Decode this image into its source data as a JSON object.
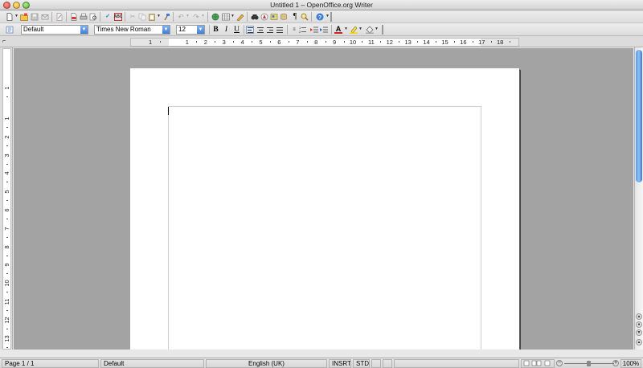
{
  "window": {
    "title": "Untitled 1 – OpenOffice.org Writer"
  },
  "formatting_toolbar": {
    "paragraph_style": "Default",
    "font_name": "Times New Roman",
    "font_size": "12",
    "bold_label": "B",
    "italic_label": "I",
    "underline_label": "U"
  },
  "standard_toolbar": {
    "icons": [
      "new-icon",
      "open-icon",
      "save-icon",
      "email-icon",
      "edit-file-icon",
      "pdf-export-icon",
      "print-icon",
      "page-preview-icon",
      "spellcheck-icon",
      "autospellcheck-icon",
      "cut-icon",
      "copy-icon",
      "paste-icon",
      "format-paintbrush-icon",
      "undo-icon",
      "redo-icon",
      "hyperlink-icon",
      "table-icon",
      "show-draw-functions-icon",
      "find-replace-icon",
      "navigator-icon",
      "gallery-icon",
      "data-sources-icon",
      "nonprinting-chars-icon",
      "zoom-icon",
      "help-icon"
    ]
  },
  "horizontal_ruler": {
    "labels": [
      "1",
      "1",
      "2",
      "3",
      "4",
      "5",
      "6",
      "7",
      "8",
      "9",
      "10",
      "11",
      "12",
      "13",
      "14",
      "15",
      "16",
      "17",
      "18"
    ]
  },
  "vertical_ruler": {
    "labels": [
      "1",
      "1",
      "2",
      "3",
      "4",
      "5",
      "6",
      "7",
      "8",
      "9",
      "10",
      "11",
      "12",
      "13"
    ]
  },
  "statusbar": {
    "page": "Page 1 / 1",
    "page_style": "Default",
    "language": "English (UK)",
    "insert_mode": "INSRT",
    "selection_mode": "STD",
    "zoom": "100%"
  },
  "colors": {
    "scroll_accent": "#5d9ae9",
    "doc_background": "#a3a3a3",
    "page": "#ffffff"
  }
}
